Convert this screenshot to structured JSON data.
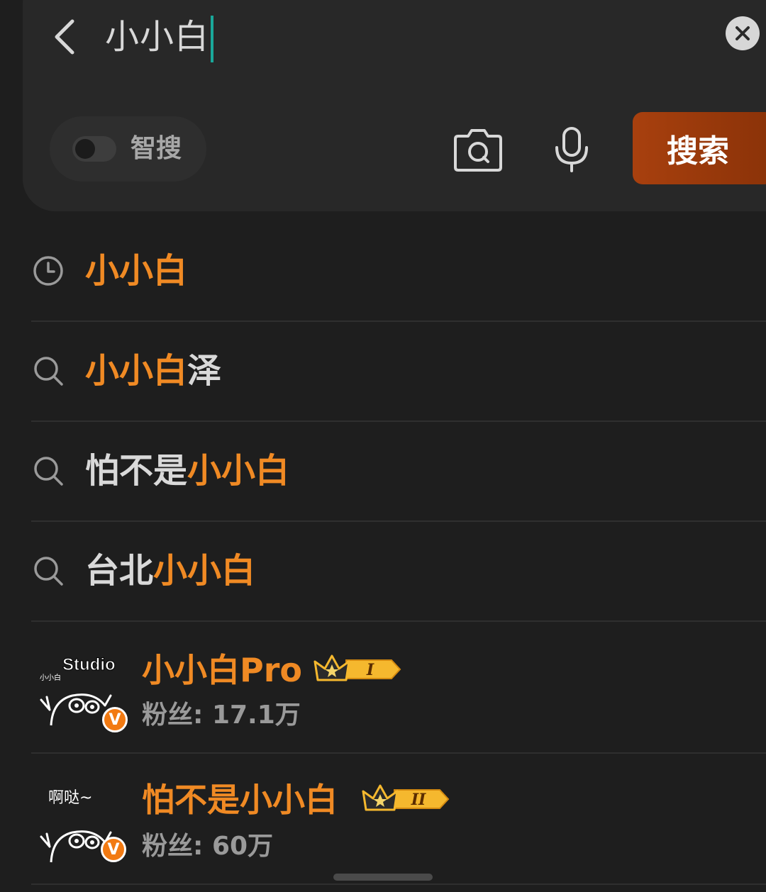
{
  "search": {
    "query": "小小白",
    "smart_search_label": "智搜",
    "smart_search_on": false,
    "search_button_label": "搜索"
  },
  "suggestions": [
    {
      "type": "history",
      "icon": "clock-icon",
      "prefix": "",
      "highlight": "小小白",
      "suffix": ""
    },
    {
      "type": "suggest",
      "icon": "search-icon",
      "prefix": "",
      "highlight": "小小白",
      "suffix": "泽"
    },
    {
      "type": "suggest",
      "icon": "search-icon",
      "prefix": "怕不是",
      "highlight": "小小白",
      "suffix": ""
    },
    {
      "type": "suggest",
      "icon": "search-icon",
      "prefix": "台北",
      "highlight": "小小白",
      "suffix": ""
    }
  ],
  "users": [
    {
      "name": "小小白Pro",
      "avatar_caption": "Studio",
      "avatar_sub_caption": "小小白",
      "level": "I",
      "fans_label": "粉丝:",
      "fans_value": "17.1万",
      "verified_mark": "V"
    },
    {
      "name": "怕不是小小白",
      "avatar_caption": "啊哒~",
      "avatar_sub_caption": "",
      "level": "II",
      "fans_label": "粉丝:",
      "fans_value": "60万",
      "verified_mark": "V"
    }
  ],
  "colors": {
    "background": "#1e1e1e",
    "panel": "#282828",
    "highlight": "#f08a24",
    "search_button": "#a8400e",
    "caret": "#1aa89a"
  }
}
